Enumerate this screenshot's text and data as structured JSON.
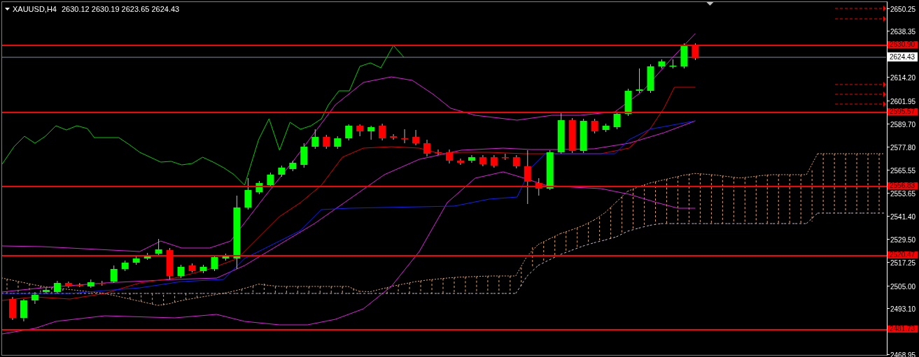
{
  "chart": {
    "symbol": "XAUUSD,H4",
    "ohlc": "2630.12 2630.19 2623.65 2624.43",
    "price_axis": {
      "ticks": [
        "2650.25",
        "2638.35",
        "2614.20",
        "2601.95",
        "2589.70",
        "2577.80",
        "2565.55",
        "2553.65",
        "2541.40",
        "2529.50",
        "2517.25",
        "2505.00",
        "2493.10",
        "2468.95"
      ]
    },
    "levels": [
      {
        "label": "2630.90"
      },
      {
        "label": "2595.57"
      },
      {
        "label": "2556.83"
      },
      {
        "label": "2520.47"
      },
      {
        "label": "2481.73"
      }
    ],
    "current_price": {
      "label": "2624.43"
    }
  }
}
